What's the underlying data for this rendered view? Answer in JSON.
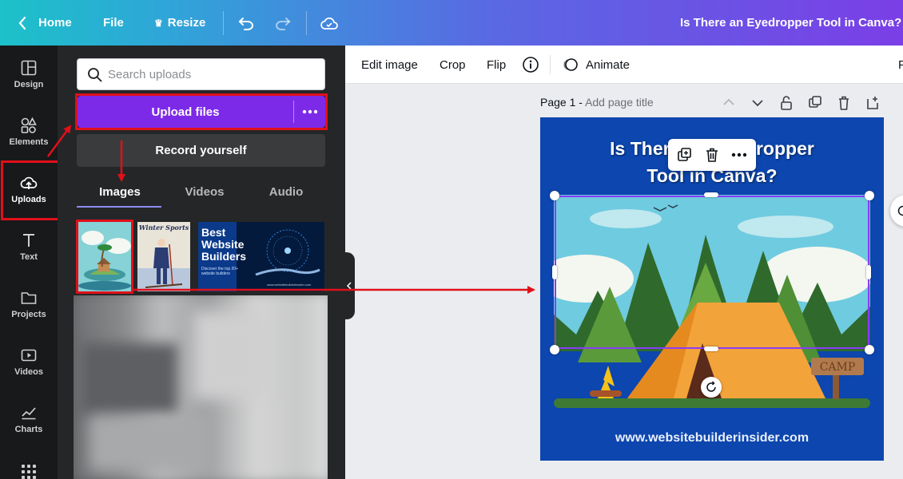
{
  "topbar": {
    "home": "Home",
    "file": "File",
    "resize": "Resize",
    "doc_title": "Is There an Eyedropper Tool in Canva?"
  },
  "rail": {
    "items": [
      {
        "label": "Design",
        "icon": "design-icon"
      },
      {
        "label": "Elements",
        "icon": "elements-icon"
      },
      {
        "label": "Uploads",
        "icon": "cloud-upload-icon"
      },
      {
        "label": "Text",
        "icon": "text-icon"
      },
      {
        "label": "Projects",
        "icon": "folder-icon"
      },
      {
        "label": "Videos",
        "icon": "video-icon"
      },
      {
        "label": "Charts",
        "icon": "chart-icon"
      }
    ]
  },
  "panel": {
    "search_placeholder": "Search uploads",
    "upload_label": "Upload files",
    "record_label": "Record yourself",
    "tabs": [
      "Images",
      "Videos",
      "Audio"
    ],
    "thumb_banner": {
      "line1": "Best",
      "line2": "Website",
      "line3": "Builders",
      "sub": "Discover the top 20+ website builders",
      "url": "www.websitebuilderinsider.com"
    },
    "thumb_poster": "Winter Sports"
  },
  "toolbar": {
    "edit_image": "Edit image",
    "crop": "Crop",
    "flip": "Flip",
    "animate": "Animate",
    "cut_off": "F"
  },
  "page": {
    "label": "Page 1 -",
    "title_placeholder": "Add page title",
    "heading_line1": "Is There an Eyedropper",
    "heading_line2": "Tool in Canva?",
    "sign": "CAMP",
    "footer_url": "www.websitebuilderinsider.com"
  },
  "colors": {
    "accent_purple": "#7d2ae8",
    "highlight_red": "#e0101a",
    "page_blue": "#0c46ae",
    "rail_bg": "#18191b",
    "panel_bg": "#252627"
  }
}
